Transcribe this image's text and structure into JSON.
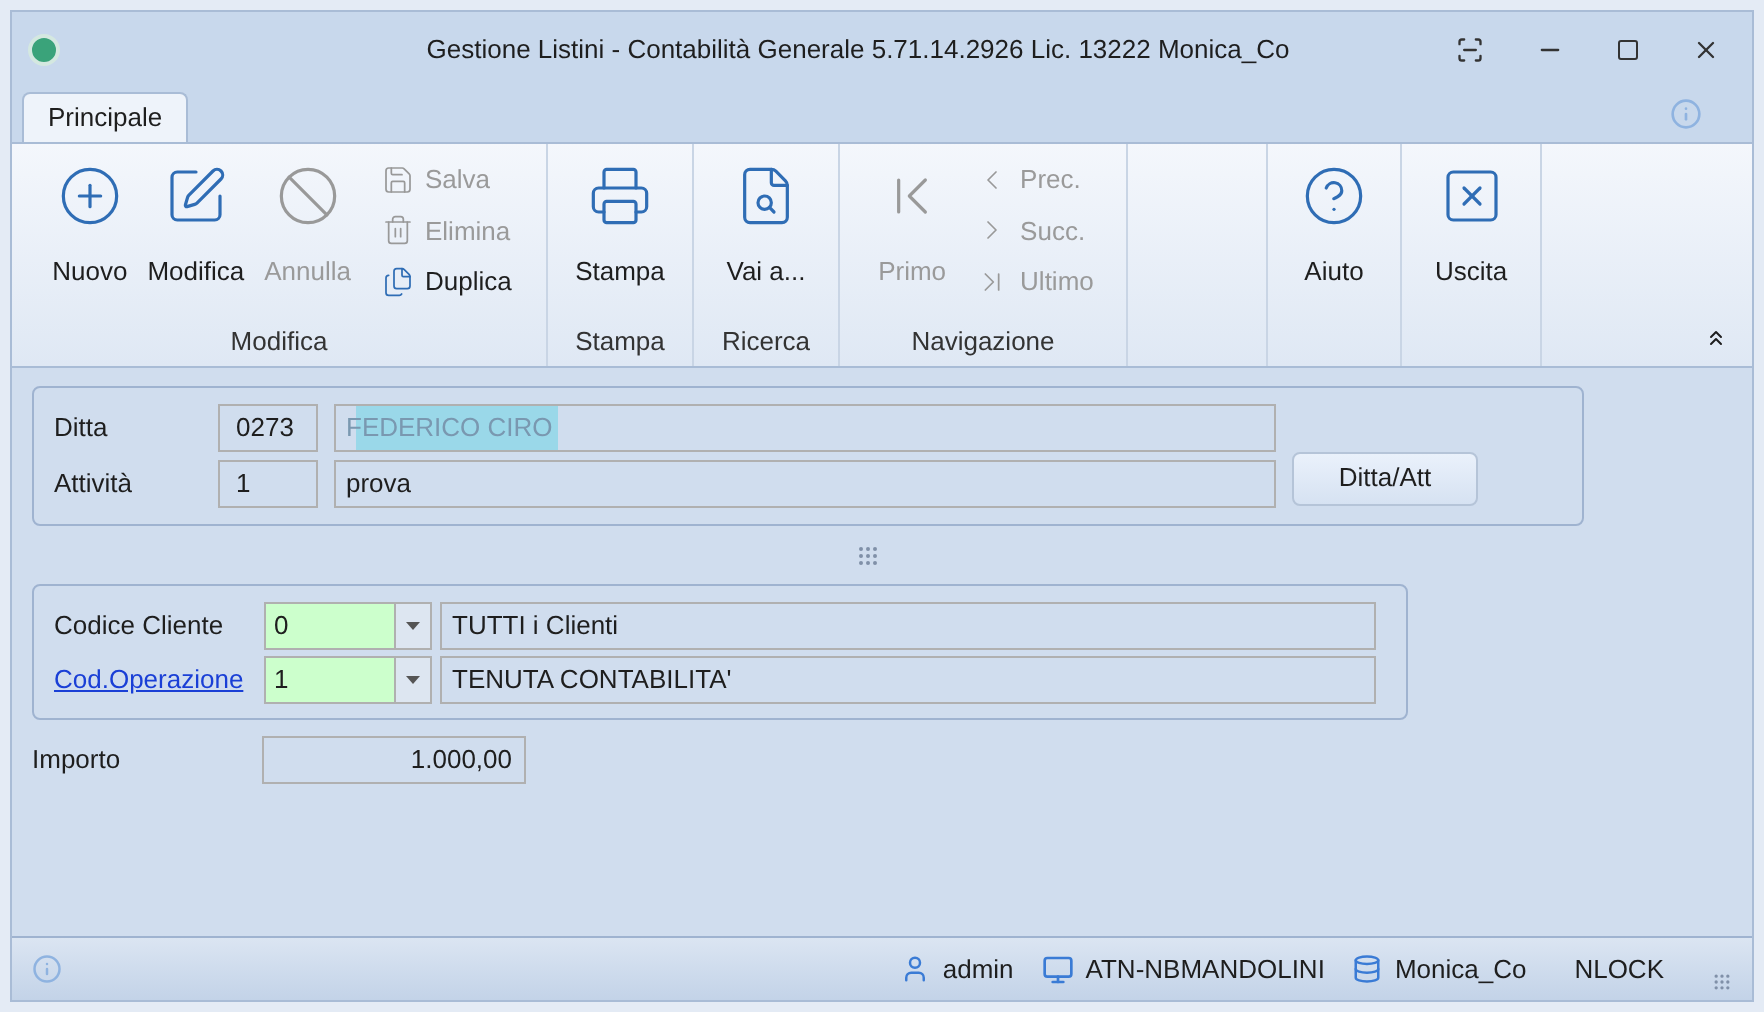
{
  "window": {
    "title": "Gestione Listini - Contabilità Generale 5.71.14.2926 Lic. 13222 Monica_Co"
  },
  "tabs": [
    {
      "label": "Principale",
      "selected": true
    }
  ],
  "ribbon": {
    "groups": [
      {
        "label": "Modifica",
        "large_buttons": [
          {
            "label": "Nuovo",
            "disabled": false
          },
          {
            "label": "Modifica",
            "disabled": false
          },
          {
            "label": "Annulla",
            "disabled": true
          }
        ],
        "small_buttons": [
          {
            "label": "Salva",
            "disabled": true
          },
          {
            "label": "Elimina",
            "disabled": true
          },
          {
            "label": "Duplica",
            "disabled": false
          }
        ]
      },
      {
        "label": "Stampa",
        "large_buttons": [
          {
            "label": "Stampa",
            "disabled": false
          }
        ]
      },
      {
        "label": "Ricerca",
        "large_buttons": [
          {
            "label": "Vai a...",
            "disabled": false
          }
        ]
      },
      {
        "label": "Navigazione",
        "large_buttons": [
          {
            "label": "Primo",
            "disabled": true
          }
        ],
        "small_buttons": [
          {
            "label": "Prec.",
            "disabled": true
          },
          {
            "label": "Succ.",
            "disabled": true
          },
          {
            "label": "Ultimo",
            "disabled": true
          }
        ]
      },
      {
        "large_buttons": [
          {
            "label": "Aiuto",
            "disabled": false
          }
        ]
      },
      {
        "large_buttons": [
          {
            "label": "Uscita",
            "disabled": false
          }
        ]
      }
    ]
  },
  "company_panel": {
    "rows": [
      {
        "label": "Ditta",
        "code": "0273",
        "name": "FEDERICO CIRO",
        "masked": true
      },
      {
        "label": "Attività",
        "code": "1",
        "name": "prova",
        "masked": false
      }
    ],
    "button": "Ditta/Att"
  },
  "client_panel": {
    "rows": [
      {
        "label": "Codice Cliente",
        "link": false,
        "value": "0",
        "description": "TUTTI i Clienti"
      },
      {
        "label": "Cod.Operazione",
        "link": true,
        "value": "1",
        "description": "TENUTA CONTABILITA'"
      }
    ]
  },
  "amount": {
    "label": "Importo",
    "value": "1.000,00"
  },
  "status_bar": {
    "user": "admin",
    "computer": "ATN-NBMANDOLINI",
    "database": "Monica_Co",
    "lock": "NLOCK"
  }
}
